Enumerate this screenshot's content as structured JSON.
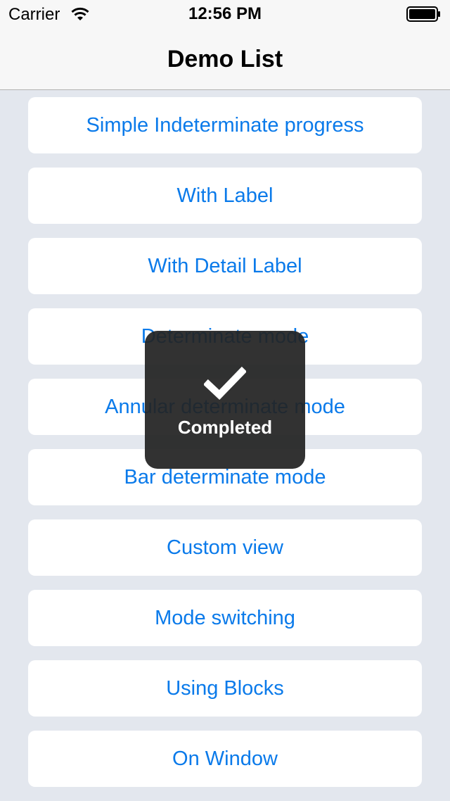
{
  "status_bar": {
    "carrier": "Carrier",
    "time": "12:56 PM",
    "wifi_icon": "wifi-icon",
    "battery_icon": "battery-icon"
  },
  "nav": {
    "title": "Demo List"
  },
  "list": {
    "items": [
      {
        "label": "Simple Indeterminate progress"
      },
      {
        "label": "With Label"
      },
      {
        "label": "With Detail Label"
      },
      {
        "label": "Determinate mode"
      },
      {
        "label": "Annular determinate mode"
      },
      {
        "label": "Bar determinate mode"
      },
      {
        "label": "Custom view"
      },
      {
        "label": "Mode switching"
      },
      {
        "label": "Using Blocks"
      },
      {
        "label": "On Window"
      }
    ]
  },
  "hud": {
    "icon": "checkmark-icon",
    "label": "Completed"
  },
  "colors": {
    "accent": "#0a7aea",
    "background": "#e3e7ee",
    "hud_background": "#222222"
  }
}
